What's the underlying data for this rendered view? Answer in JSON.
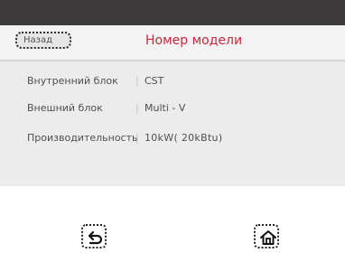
{
  "header": {
    "back_label": "Назад",
    "title": "Номер модели"
  },
  "info_rows": [
    {
      "label": "Внутренний блок",
      "value": "CST"
    },
    {
      "label": "Внешний блок",
      "value": "Multi - V"
    },
    {
      "label": "Производительность",
      "value": "10kW( 20kBtu)"
    }
  ],
  "footer": {
    "return_icon": "return-arrow-icon",
    "home_icon": "home-icon"
  },
  "colors": {
    "title": "#c8283d",
    "topbar": "#3d3a3b",
    "panel": "#ececec"
  }
}
